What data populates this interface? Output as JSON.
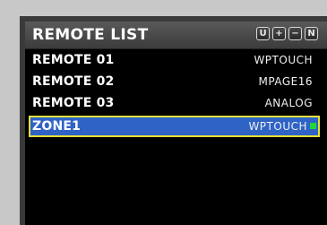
{
  "header": {
    "title": "REMOTE LIST",
    "buttons": [
      "U",
      "+",
      "−",
      "N"
    ]
  },
  "remotes": [
    {
      "name": "REMOTE 01",
      "type": "WPTOUCH",
      "selected": false
    },
    {
      "name": "REMOTE 02",
      "type": "MPAGE16",
      "selected": false
    },
    {
      "name": "REMOTE 03",
      "type": "ANALOG",
      "selected": false
    },
    {
      "name": "ZONE1",
      "type": "WPTOUCH",
      "selected": true
    }
  ],
  "colors": {
    "selected_bg": "#2f63c6",
    "selected_border": "#e6e03a",
    "status_online": "#22d63b"
  }
}
